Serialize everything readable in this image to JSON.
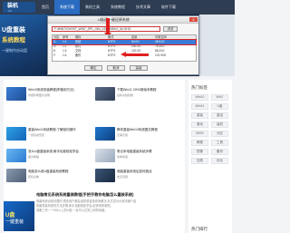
{
  "site": {
    "logo_text": "装机",
    "logo_sub": ".cn"
  },
  "nav": {
    "items": [
      "首页",
      "系统下载",
      "装机工具",
      "系统教程",
      "技术文章",
      "软件下载"
    ],
    "active_index": 1
  },
  "hero": {
    "title1": "U盘重装",
    "title2": "系统教程",
    "sub": "一键制作启动盘"
  },
  "dialog": {
    "title": "U极速一键还原系统",
    "close_label": "X",
    "path_value": "F:\\WIN7\\GHOST_WIN7_SP1_X64_V2019\\Win7_64.GHO",
    "browse_label": "浏览",
    "columns": [
      "分区",
      "序号",
      "卷标",
      "格式",
      "容量",
      "可用空间"
    ],
    "rows": [
      [
        "C:",
        "1:1",
        "系统",
        "NTFS",
        "60.0G",
        "45.51G"
      ],
      [
        "D:",
        "1:2",
        "软件",
        "NTFS",
        "100.0G",
        "76.30G"
      ],
      [
        "E:",
        "1:3",
        "文档",
        "NTFS",
        "120.0G",
        "88.20G"
      ],
      [
        "F:",
        "1:4",
        "备份",
        "NTFS",
        "185.7G",
        "102.90G"
      ]
    ],
    "selected_row": 0,
    "buttons": [
      "确定",
      "取消",
      "高级"
    ]
  },
  "cards_left": [
    {
      "title": "Win10系统安装教程(附使用方法)",
      "desc": "详细步骤图文说明"
    },
    {
      "title": "重装Win11系统教程:了解如何操作",
      "desc": "一键完成安装"
    },
    {
      "title": "怎么U盘重装系统:新手也能轻松学会",
      "desc": "图文教程"
    },
    {
      "title": "电脑怎么用U盘重装系统教程",
      "desc": "装机必看"
    }
  ],
  "cards_right": [
    {
      "title": "下载Win11 22H2新版本教程",
      "desc": "最新系统镜像"
    },
    {
      "title": "教你重装Win10系统图文教程",
      "desc": "无需光驱"
    },
    {
      "title": "笔记本电脑重装系统步骤",
      "desc": "简单易懂"
    },
    {
      "title": "电脑重装系统后如何激活",
      "desc": "常见问题"
    }
  ],
  "sidebar": {
    "title": "热门标签",
    "tags": [
      "Win10",
      "Win7",
      "Win11",
      "U盘",
      "重装",
      "激活",
      "驱动",
      "装机",
      "BIOS",
      "分区",
      "教程",
      "工具",
      "镜像",
      "备份",
      "还原",
      "优化"
    ],
    "title2": "热门排行"
  },
  "article": {
    "title": "电脑常见系统系统重装教程(手把手教你电脑怎么重装系统)",
    "lines": [
      "电脑系统出现问题时,很多用户都会选择重装系统来解决,本文将为大家详细介绍",
      "电脑重装系统的方法步骤,新手也能轻松学会,赶快来看看吧。",
      "准备工作:一个8G以上的U盘,一台可以正常上网的电脑。"
    ],
    "img_text1": "U盘",
    "img_text2": "一键重装"
  },
  "colors": {
    "nav_bg": "#2e3d52",
    "accent": "#2a6cc1",
    "alert_red": "#e02020"
  }
}
